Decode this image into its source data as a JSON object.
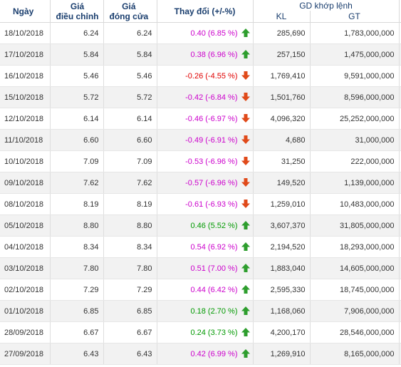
{
  "header": {
    "date": "Ngày",
    "adj_line1": "Giá",
    "adj_line2": "điều chỉnh",
    "close_line1": "Giá",
    "close_line2": "đóng cửa",
    "change": "Thay đổi (+/-%)",
    "gd_group": "GD khớp lệnh",
    "kl": "KL",
    "gt": "GT"
  },
  "colors": {
    "up": "#cc00cc",
    "down": "#e00000",
    "ceiling_or_gain": "#009900",
    "arrow_up": "#2e9e2e",
    "arrow_down": "#e04a1a"
  },
  "rows": [
    {
      "date": "18/10/2018",
      "adj": "6.24",
      "close": "6.24",
      "change": "0.40 (6.85 %)",
      "tone": "up",
      "dir": "up",
      "kl": "285,690",
      "gt": "1,783,000,000"
    },
    {
      "date": "17/10/2018",
      "adj": "5.84",
      "close": "5.84",
      "change": "0.38 (6.96 %)",
      "tone": "up",
      "dir": "up",
      "kl": "257,150",
      "gt": "1,475,000,000"
    },
    {
      "date": "16/10/2018",
      "adj": "5.46",
      "close": "5.46",
      "change": "-0.26 (-4.55 %)",
      "tone": "down",
      "dir": "down",
      "kl": "1,769,410",
      "gt": "9,591,000,000"
    },
    {
      "date": "15/10/2018",
      "adj": "5.72",
      "close": "5.72",
      "change": "-0.42 (-6.84 %)",
      "tone": "up",
      "dir": "down",
      "kl": "1,501,760",
      "gt": "8,596,000,000"
    },
    {
      "date": "12/10/2018",
      "adj": "6.14",
      "close": "6.14",
      "change": "-0.46 (-6.97 %)",
      "tone": "up",
      "dir": "down",
      "kl": "4,096,320",
      "gt": "25,252,000,000"
    },
    {
      "date": "11/10/2018",
      "adj": "6.60",
      "close": "6.60",
      "change": "-0.49 (-6.91 %)",
      "tone": "up",
      "dir": "down",
      "kl": "4,680",
      "gt": "31,000,000"
    },
    {
      "date": "10/10/2018",
      "adj": "7.09",
      "close": "7.09",
      "change": "-0.53 (-6.96 %)",
      "tone": "up",
      "dir": "down",
      "kl": "31,250",
      "gt": "222,000,000"
    },
    {
      "date": "09/10/2018",
      "adj": "7.62",
      "close": "7.62",
      "change": "-0.57 (-6.96 %)",
      "tone": "up",
      "dir": "down",
      "kl": "149,520",
      "gt": "1,139,000,000"
    },
    {
      "date": "08/10/2018",
      "adj": "8.19",
      "close": "8.19",
      "change": "-0.61 (-6.93 %)",
      "tone": "up",
      "dir": "down",
      "kl": "1,259,010",
      "gt": "10,483,000,000"
    },
    {
      "date": "05/10/2018",
      "adj": "8.80",
      "close": "8.80",
      "change": "0.46 (5.52 %)",
      "tone": "flat",
      "dir": "up",
      "kl": "3,607,370",
      "gt": "31,805,000,000"
    },
    {
      "date": "04/10/2018",
      "adj": "8.34",
      "close": "8.34",
      "change": "0.54 (6.92 %)",
      "tone": "up",
      "dir": "up",
      "kl": "2,194,520",
      "gt": "18,293,000,000"
    },
    {
      "date": "03/10/2018",
      "adj": "7.80",
      "close": "7.80",
      "change": "0.51 (7.00 %)",
      "tone": "up",
      "dir": "up",
      "kl": "1,883,040",
      "gt": "14,605,000,000"
    },
    {
      "date": "02/10/2018",
      "adj": "7.29",
      "close": "7.29",
      "change": "0.44 (6.42 %)",
      "tone": "up",
      "dir": "up",
      "kl": "2,595,330",
      "gt": "18,745,000,000"
    },
    {
      "date": "01/10/2018",
      "adj": "6.85",
      "close": "6.85",
      "change": "0.18 (2.70 %)",
      "tone": "flat",
      "dir": "up",
      "kl": "1,168,060",
      "gt": "7,906,000,000"
    },
    {
      "date": "28/09/2018",
      "adj": "6.67",
      "close": "6.67",
      "change": "0.24 (3.73 %)",
      "tone": "flat",
      "dir": "up",
      "kl": "4,200,170",
      "gt": "28,546,000,000"
    },
    {
      "date": "27/09/2018",
      "adj": "6.43",
      "close": "6.43",
      "change": "0.42 (6.99 %)",
      "tone": "up",
      "dir": "up",
      "kl": "1,269,910",
      "gt": "8,165,000,000"
    }
  ]
}
